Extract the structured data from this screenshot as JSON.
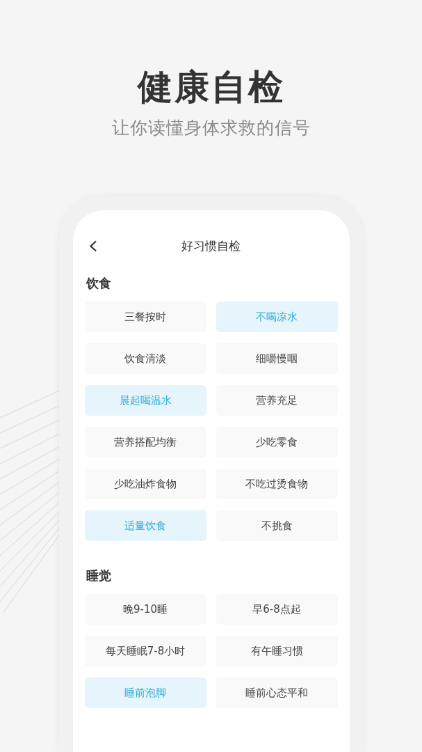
{
  "headline": "健康自检",
  "subtitle": "让你读懂身体求救的信号",
  "screen": {
    "title": "好习惯自检",
    "sections": [
      {
        "title": "饮食",
        "items": [
          {
            "label": "三餐按时",
            "selected": false
          },
          {
            "label": "不喝凉水",
            "selected": true
          },
          {
            "label": "饮食清淡",
            "selected": false
          },
          {
            "label": "细嚼慢咽",
            "selected": false
          },
          {
            "label": "晨起喝温水",
            "selected": true
          },
          {
            "label": "营养充足",
            "selected": false
          },
          {
            "label": "营养搭配均衡",
            "selected": false
          },
          {
            "label": "少吃零食",
            "selected": false
          },
          {
            "label": "少吃油炸食物",
            "selected": false
          },
          {
            "label": "不吃过烫食物",
            "selected": false
          },
          {
            "label": "适量饮食",
            "selected": true
          },
          {
            "label": "不挑食",
            "selected": false
          }
        ]
      },
      {
        "title": "睡觉",
        "items": [
          {
            "label": "晚9-10睡",
            "selected": false
          },
          {
            "label": "早6-8点起",
            "selected": false
          },
          {
            "label": "每天睡眠7-8小时",
            "selected": false
          },
          {
            "label": "有午睡习惯",
            "selected": false
          },
          {
            "label": "睡前泡脚",
            "selected": true
          },
          {
            "label": "睡前心态平和",
            "selected": false
          }
        ]
      }
    ]
  }
}
